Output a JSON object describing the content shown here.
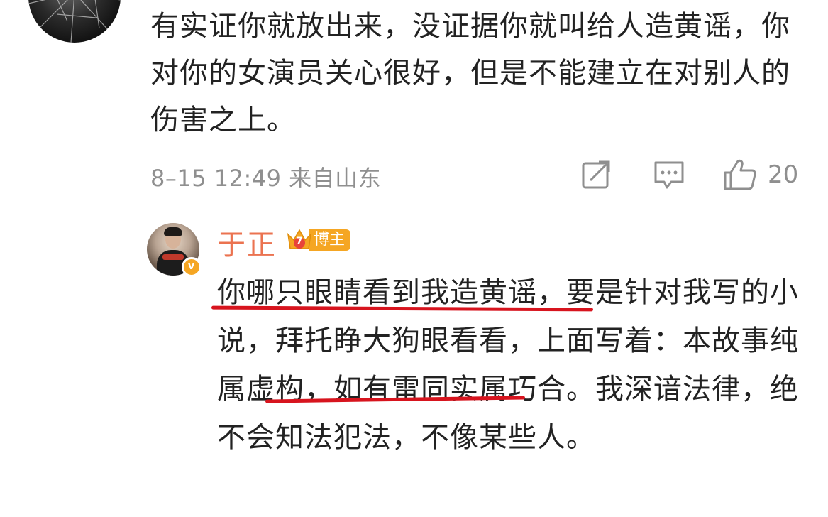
{
  "previous_comment": {
    "text": "有实证你就放出来，没证据你就叫给人造黄谣，你对你的女演员关心很好，但是不能建立在对别人的伤害之上。",
    "meta": "8–15 12:49 来自山东",
    "actions": {
      "share_icon": "share-icon",
      "comment_icon": "comment-icon",
      "like_icon": "thumbs-up-icon",
      "like_count": "20"
    }
  },
  "reply": {
    "author": "于正",
    "badge_label": "博主",
    "badge_level": "7",
    "text": "你哪只眼睛看到我造黄谣，要是针对我写的小说，拜托睁大狗眼看看，上面写着：本故事纯属虚构，如有雷同实属巧合。我深谙法律，绝不会知法犯法，不像某些人。"
  },
  "colors": {
    "name": "#eb7350",
    "meta": "#8f8f8f",
    "badge": "#f5a623",
    "underline": "#d7141e",
    "text": "#222222"
  }
}
